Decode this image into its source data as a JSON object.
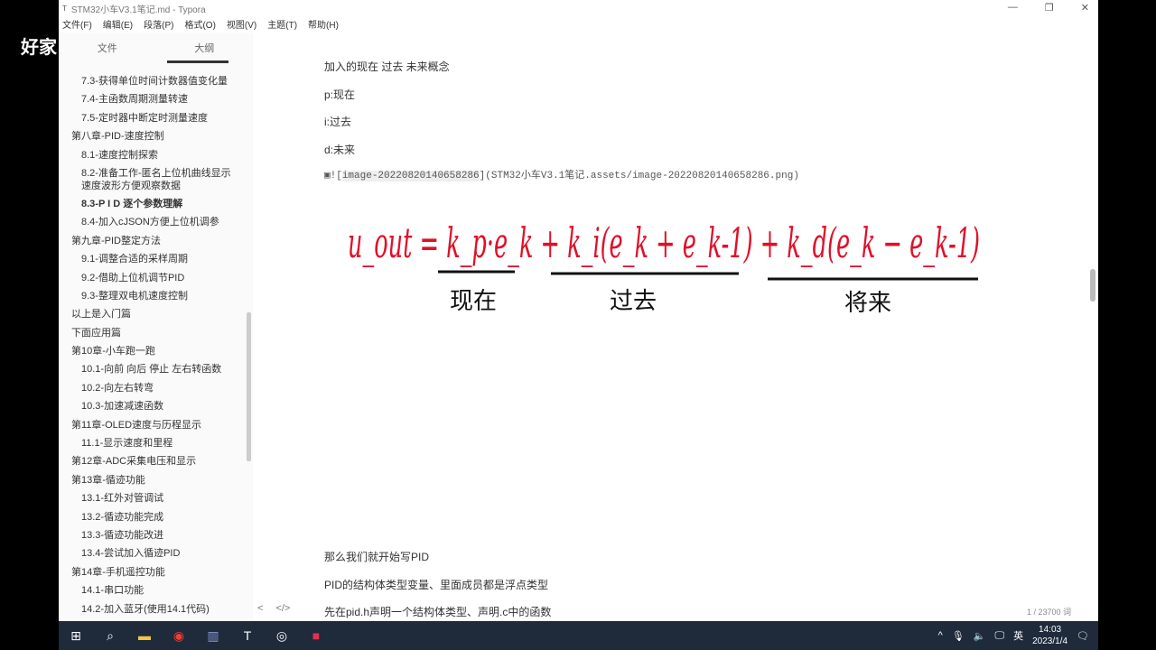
{
  "watermark": "好家",
  "window": {
    "title": "STM32小车V3.1笔记.md - Typora",
    "app_icon": "T",
    "controls": [
      "—",
      "❐",
      "✕"
    ]
  },
  "menu": [
    "文件(F)",
    "编辑(E)",
    "段落(P)",
    "格式(O)",
    "视图(V)",
    "主题(T)",
    "帮助(H)"
  ],
  "sidebar": {
    "tabs": [
      "文件",
      "大纲"
    ],
    "items": [
      {
        "label": "7.3-获得单位时间计数器值变化量",
        "level": 2
      },
      {
        "label": "7.4-主函数周期测量转速",
        "level": 2
      },
      {
        "label": "7.5-定时器中断定时测量速度",
        "level": 2
      },
      {
        "label": "第八章-PID-速度控制",
        "level": 1
      },
      {
        "label": "8.1-速度控制探索",
        "level": 2
      },
      {
        "label": "8.2-准备工作-匿名上位机曲线显示速度波形方便观察数据",
        "level": 2,
        "two": true
      },
      {
        "label": "8.3-P I D 逐个参数理解",
        "level": 2,
        "active": true
      },
      {
        "label": "8.4-加入cJSON方便上位机调参",
        "level": 2
      },
      {
        "label": "第九章-PID整定方法",
        "level": 1
      },
      {
        "label": "9.1-调整合适的采样周期",
        "level": 2
      },
      {
        "label": "9.2-借助上位机调节PID",
        "level": 2
      },
      {
        "label": "9.3-整理双电机速度控制",
        "level": 2
      },
      {
        "label": "以上是入门篇",
        "level": 1
      },
      {
        "label": "下面应用篇",
        "level": 1
      },
      {
        "label": "第10章-小车跑一跑",
        "level": 1
      },
      {
        "label": "10.1-向前 向后 停止 左右转函数",
        "level": 2
      },
      {
        "label": "10.2-向左右转弯",
        "level": 2
      },
      {
        "label": "10.3-加速减速函数",
        "level": 2
      },
      {
        "label": "第11章-OLED速度与历程显示",
        "level": 1
      },
      {
        "label": "11.1-显示速度和里程",
        "level": 2
      },
      {
        "label": "第12章-ADC采集电压和显示",
        "level": 1
      },
      {
        "label": "第13章-循迹功能",
        "level": 1
      },
      {
        "label": "13.1-红外对管调试",
        "level": 2
      },
      {
        "label": "13.2-循迹功能完成",
        "level": 2
      },
      {
        "label": "13.3-循迹功能改进",
        "level": 2
      },
      {
        "label": "13.4-尝试加入循迹PID",
        "level": 2
      },
      {
        "label": "第14章-手机遥控功能",
        "level": 1
      },
      {
        "label": "14.1-串口功能",
        "level": 2
      },
      {
        "label": "14.2-加入蓝牙(使用14.1代码)",
        "level": 2
      }
    ]
  },
  "content": {
    "p1": "加入的现在 过去 未来概念",
    "p2": "p:现在",
    "p3": "i:过去",
    "p4": "d:未来",
    "img_alt": "image-20220820140658286",
    "img_path": "(STM32小车V3.1笔记.assets/image-20220820140658286.png)",
    "formula": "u_out = k_p·e_k + k_i(e_k + e_k-1) + k_d(e_k − e_k-1)",
    "labels": [
      "现在",
      "过去",
      "将来"
    ],
    "p5": "那么我们就开始写PID",
    "p6": "PID的结构体类型变量、里面成员都是浮点类型",
    "p7": "先在pid.h声明一个结构体类型、声明.c中的函数"
  },
  "status": {
    "word_count": "1 / 23700 词",
    "left_icons": [
      "<",
      "</>"
    ]
  },
  "taskbar": {
    "ime": "英",
    "time": "14:03",
    "date": "2023/1/4"
  },
  "colors": {
    "ink": "#e0102a",
    "taskbar": "#1f2a3b"
  }
}
